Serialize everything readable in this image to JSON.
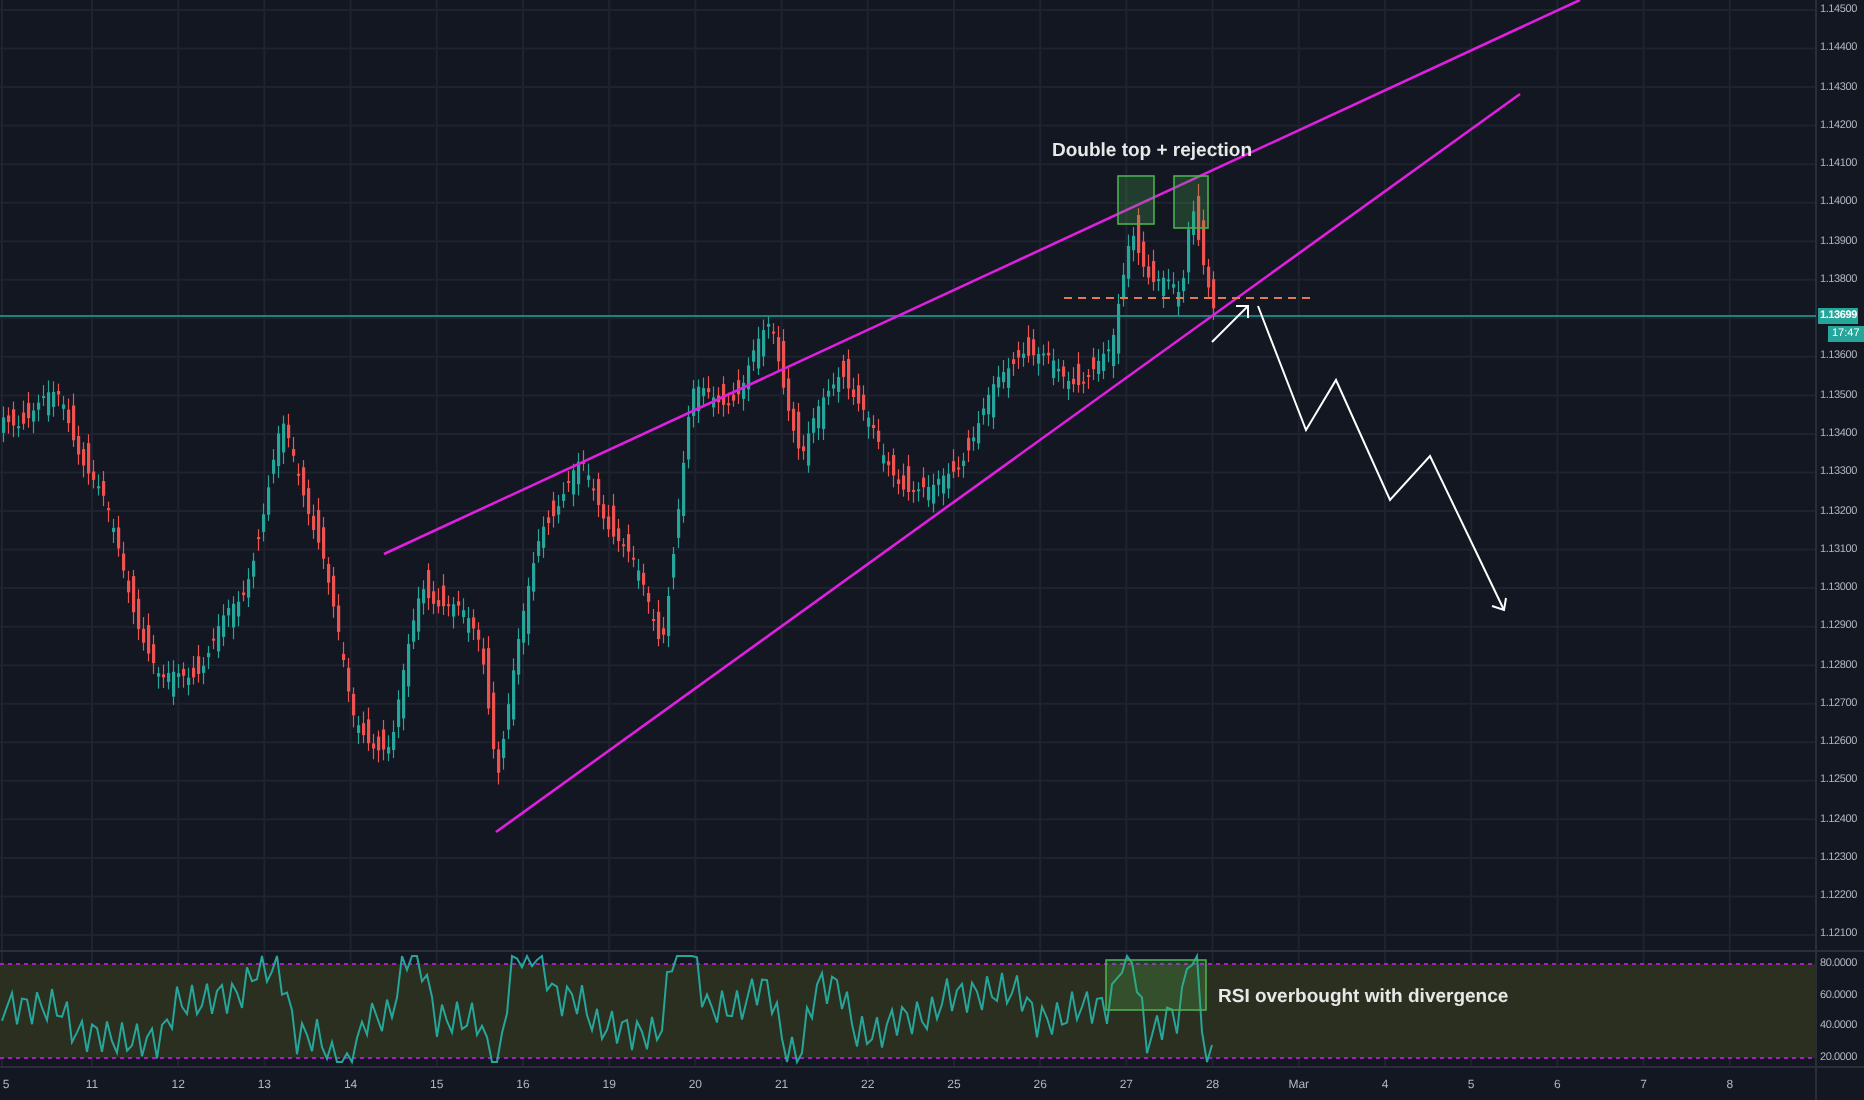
{
  "price_axis": {
    "labels_above": [
      "1.14500",
      "1.14400",
      "1.14300",
      "1.14200",
      "1.14100",
      "1.14000",
      "1.13900",
      "1.13800"
    ],
    "labels_below": [
      "1.13600",
      "1.13500",
      "1.13400",
      "1.13300",
      "1.13200",
      "1.13100",
      "1.13000",
      "1.12900",
      "1.12800",
      "1.12700",
      "1.12600",
      "1.12500",
      "1.12400",
      "1.12300",
      "1.12200",
      "1.12100"
    ]
  },
  "current_price": {
    "label": "1.13699",
    "countdown": "17:47"
  },
  "rsi_axis": {
    "labels": [
      "80.0000",
      "60.0000",
      "40.0000",
      "20.0000"
    ]
  },
  "time_axis": {
    "labels": [
      "5",
      "11",
      "12",
      "13",
      "14",
      "15",
      "16",
      "19",
      "20",
      "21",
      "22",
      "25",
      "26",
      "27",
      "28",
      "Mar",
      "4",
      "5",
      "6",
      "7",
      "8"
    ]
  },
  "annotations": [
    {
      "kind": "price",
      "text": "Double top + rejection"
    },
    {
      "kind": "rsi",
      "text": "RSI overbought with divergence"
    }
  ]
}
